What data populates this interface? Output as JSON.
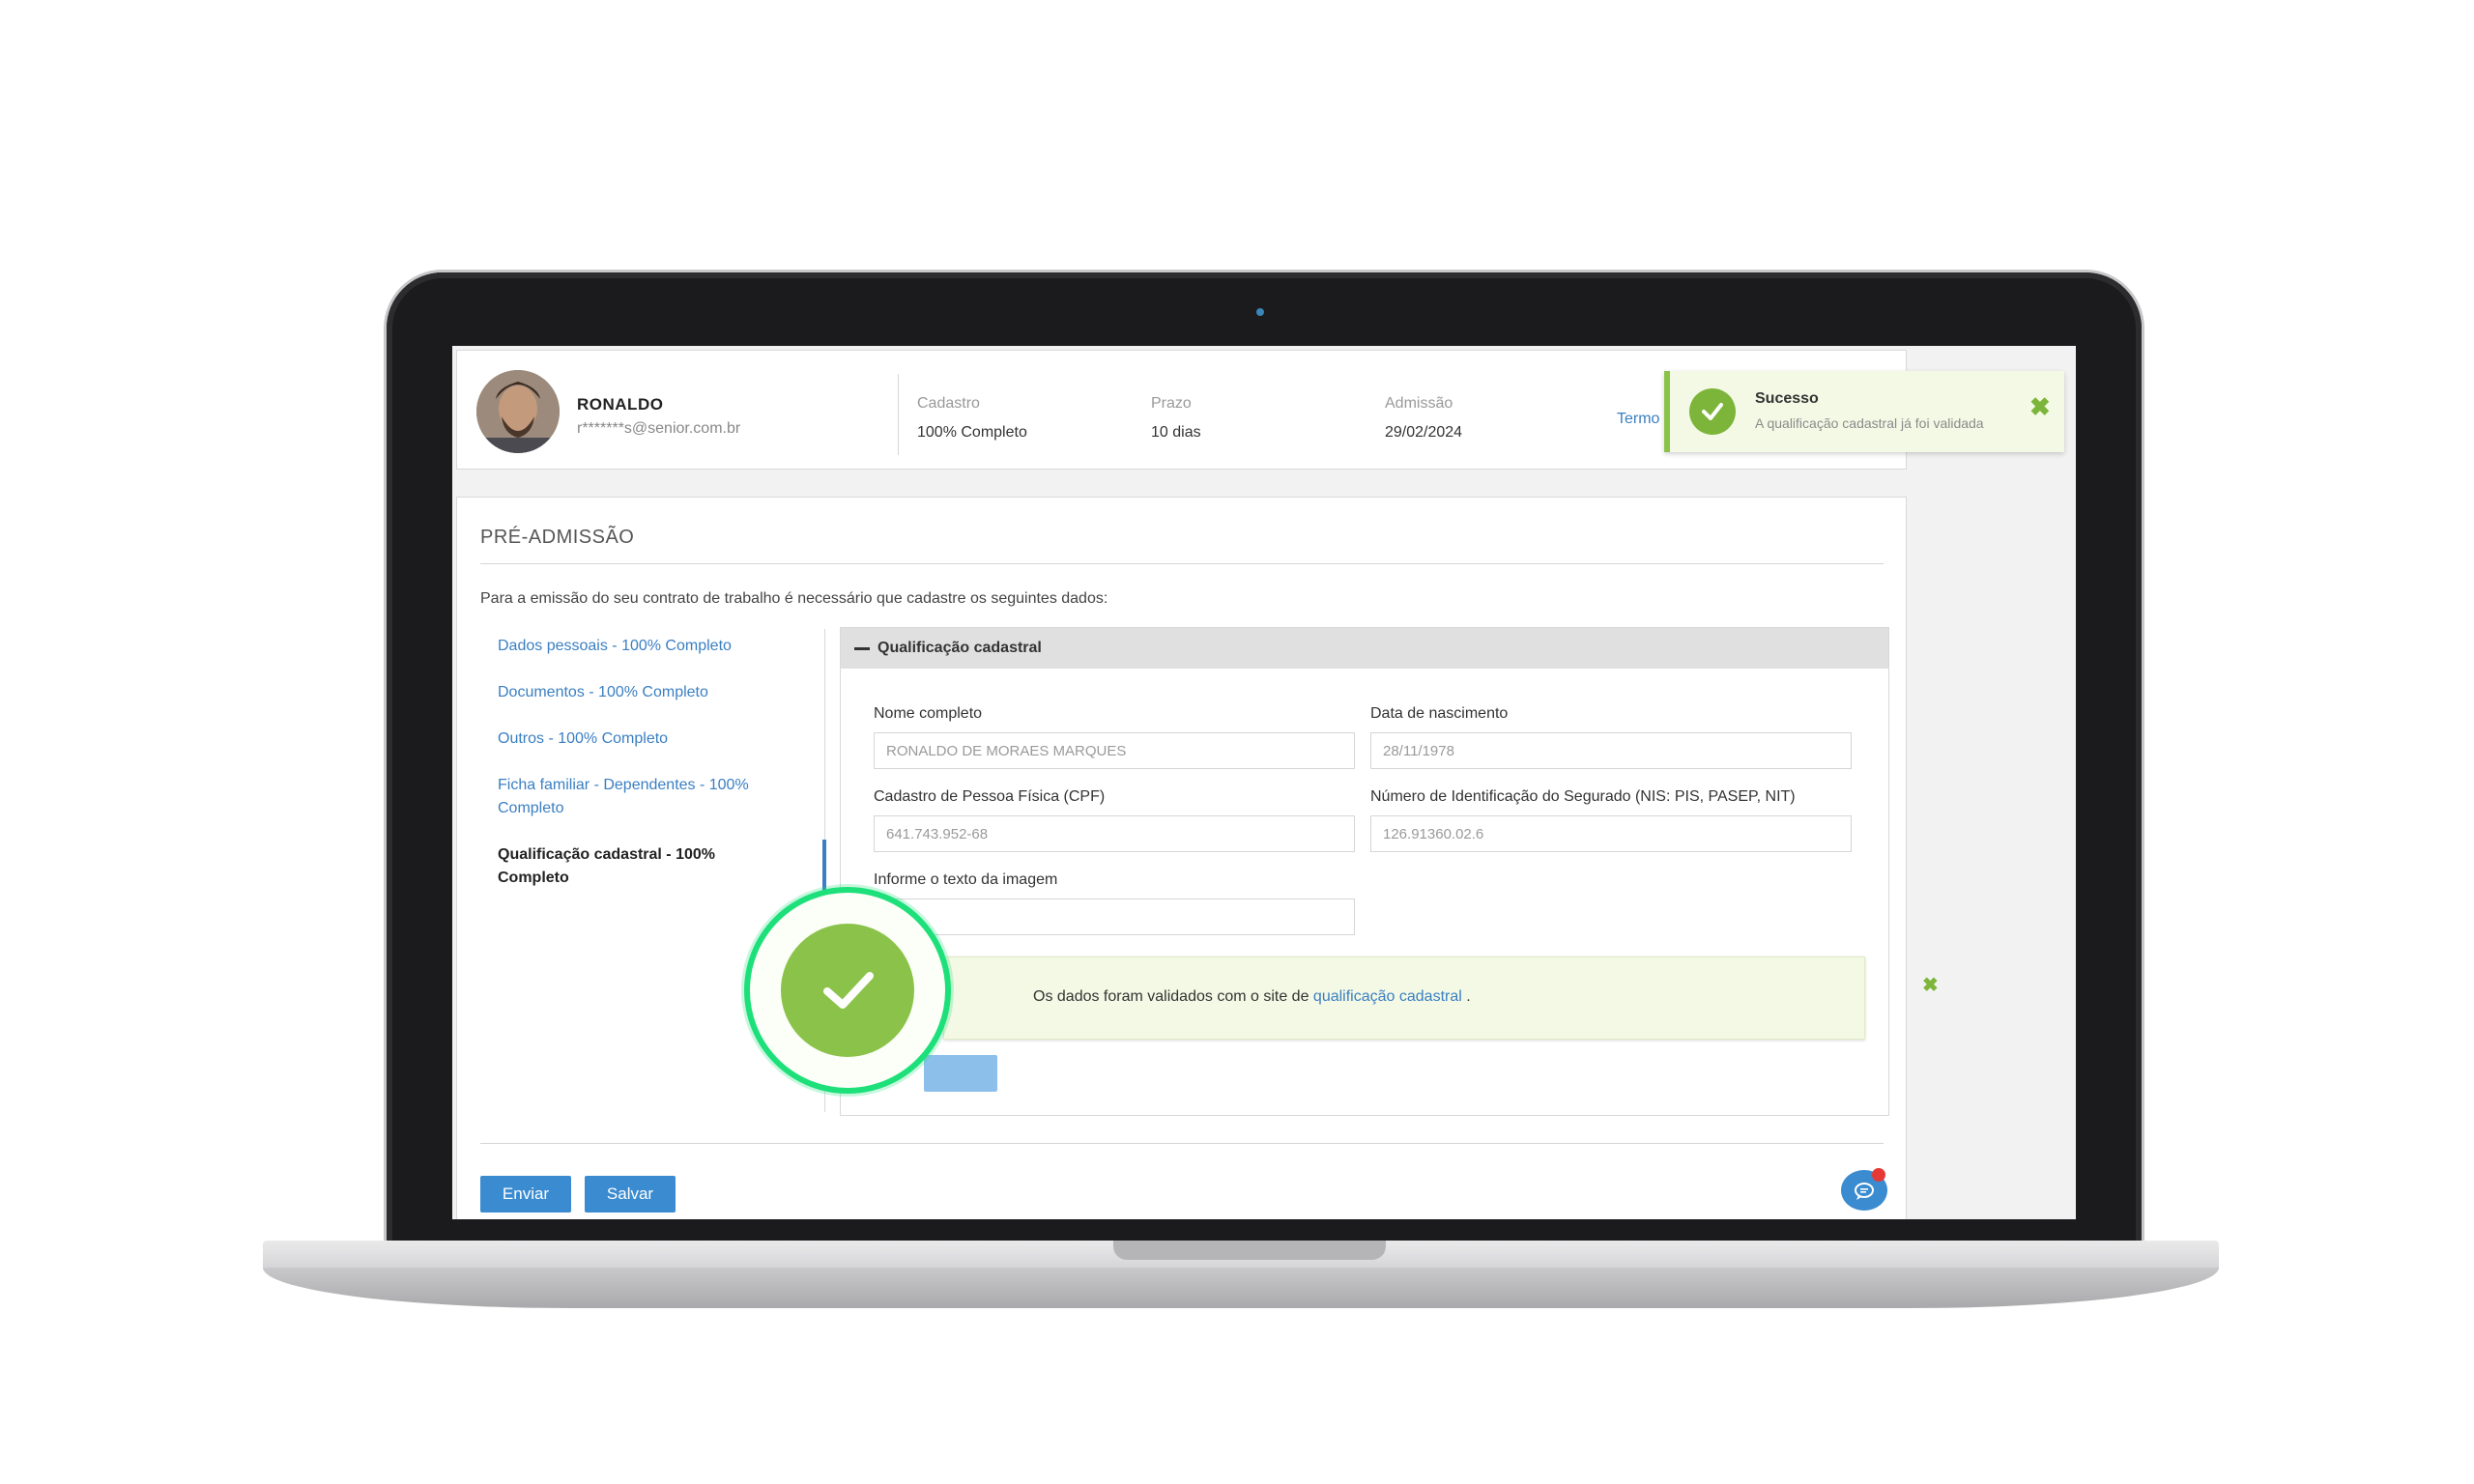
{
  "user": {
    "name": "RONALDO",
    "email": "r*******s@senior.com.br"
  },
  "stats": [
    {
      "label": "Cadastro",
      "value": "100% Completo"
    },
    {
      "label": "Prazo",
      "value": "10 dias"
    },
    {
      "label": "Admissão",
      "value": "29/02/2024"
    }
  ],
  "header": {
    "termo_link": "Termo"
  },
  "toast": {
    "title": "Sucesso",
    "message": "A qualificação cadastral já foi validada",
    "close": "✖"
  },
  "page": {
    "section_title": "PRÉ-ADMISSÃO",
    "intro": "Para a emissão do seu contrato de trabalho é necessário que cadastre os seguintes dados:"
  },
  "nav": {
    "items": [
      {
        "label": "Dados pessoais - 100% Completo"
      },
      {
        "label": "Documentos - 100% Completo"
      },
      {
        "label": "Outros - 100% Completo"
      },
      {
        "label": "Ficha familiar - Dependentes - 100% Completo"
      },
      {
        "label": "Qualificação cadastral - 100% Completo"
      }
    ]
  },
  "accordion": {
    "title": "Qualificação cadastral",
    "fields": {
      "nome_label": "Nome completo",
      "nome_value": "RONALDO DE MORAES MARQUES",
      "nascimento_label": "Data de nascimento",
      "nascimento_value": "28/11/1978",
      "cpf_label": "Cadastro de Pessoa Física (CPF)",
      "cpf_value": "641.743.952-68",
      "nis_label": "Número de Identificação do Segurado (NIS: PIS, PASEP, NIT)",
      "nis_value": "126.91360.02.6",
      "captcha_label": "Informe o texto da imagem",
      "captcha_value": ""
    },
    "alert": {
      "text_before": "Os dados foram validados com o site de ",
      "link": "qualificação cadastral",
      "text_after": " .",
      "close": "✖"
    }
  },
  "actions": {
    "send": "Enviar",
    "save": "Salvar"
  },
  "colors": {
    "primary": "#3a8bd0",
    "link": "#3a7fc2",
    "success": "#8bc34a",
    "success_bg": "#f4f9e5",
    "highlight_ring": "#1ee07a"
  },
  "icons": {
    "toast": "check-icon",
    "validation": "check-icon",
    "chat": "chat-bubble-icon"
  }
}
